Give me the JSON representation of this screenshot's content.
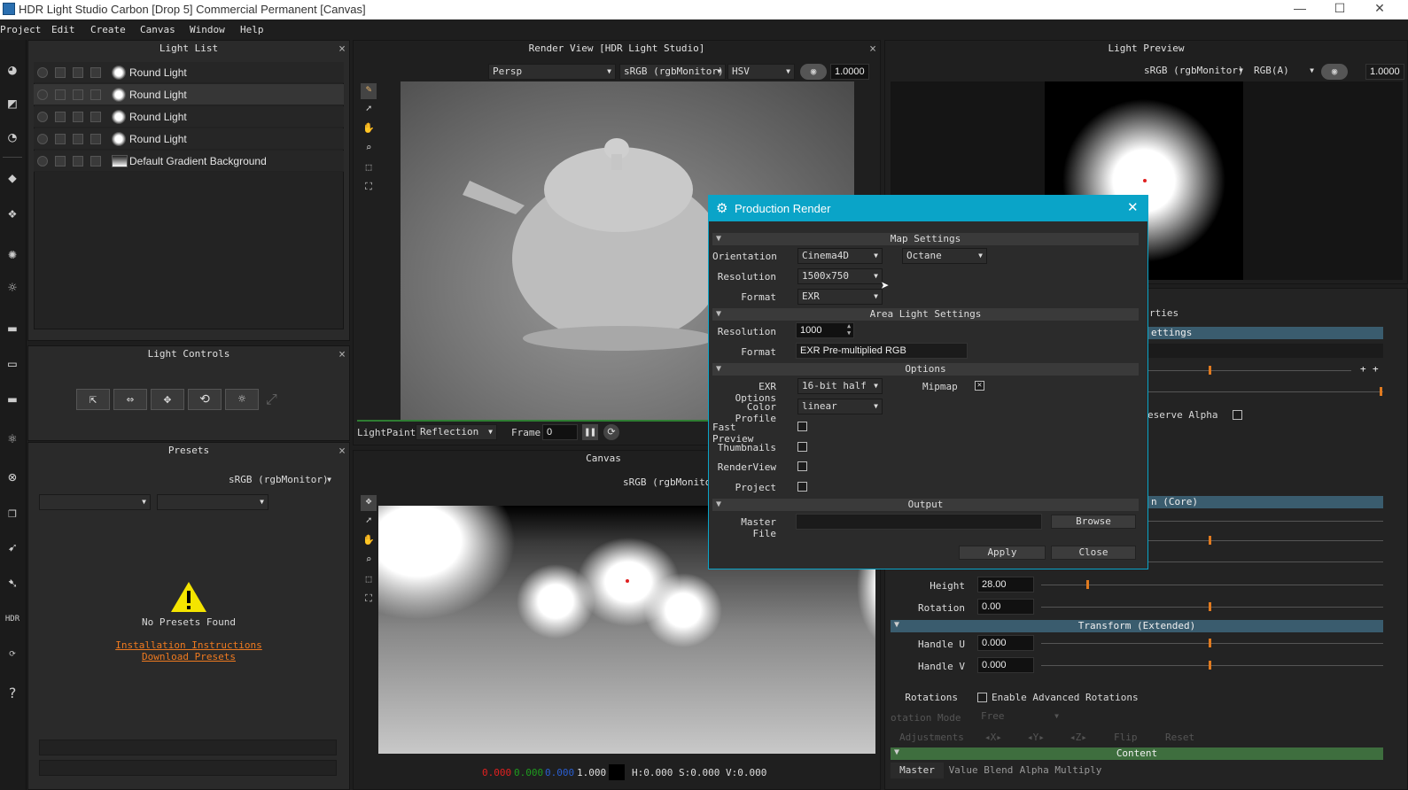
{
  "window": {
    "title": "HDR Light Studio Carbon [Drop 5] Commercial Permanent [Canvas]",
    "minimize": "—",
    "maximize": "☐",
    "close": "✕"
  },
  "menu": [
    "Project",
    "Edit",
    "Create",
    "Canvas",
    "Window",
    "Help"
  ],
  "light_list": {
    "title": "Light List",
    "items": [
      "Round Light",
      "Round Light",
      "Round Light",
      "Round Light",
      "Default Gradient Background"
    ]
  },
  "light_controls": {
    "title": "Light Controls"
  },
  "presets": {
    "title": "Presets",
    "colorspace": "sRGB (rgbMonitor)",
    "empty_text": "No Presets Found",
    "link1": "Installation Instructions",
    "link2": "Download Presets"
  },
  "render_view": {
    "title": "Render View [HDR Light Studio]",
    "camera": "Persp",
    "colorspace": "sRGB (rgbMonitor)",
    "mode": "HSV",
    "exposure": "1.0000",
    "lightpaint_label": "LightPaint",
    "lightpaint_mode": "Reflection",
    "frame_label": "Frame",
    "frame_value": "0"
  },
  "canvas": {
    "title": "Canvas",
    "colorspace": "sRGB (rgbMonitor)",
    "r": "0.000",
    "g": "0.000",
    "b": "0.000",
    "a": "1.000",
    "hsv": "H:0.000 S:0.000 V:0.000"
  },
  "light_preview": {
    "title": "Light Preview",
    "colorspace": "sRGB (rgbMonitor)",
    "mode": "RGB(A)",
    "exposure": "1.0000"
  },
  "properties": {
    "title": "rties",
    "settings": "ettings",
    "preserve_alpha": "eserve Alpha",
    "core": "n (Core)",
    "height_label": "Height",
    "height": "28.00",
    "rotation_label": "Rotation",
    "rotation": "0.00",
    "transform_ext": "Transform (Extended)",
    "handle_u_label": "Handle U",
    "handle_u": "0.000",
    "handle_v_label": "Handle V",
    "handle_v": "0.000",
    "rotations_label": "Rotations",
    "enable_adv": "Enable Advanced Rotations",
    "rotation_mode_label": "otation Mode",
    "rotation_mode": "Free",
    "adjustments_label": "Adjustments",
    "adj_x": "X",
    "adj_y": "Y",
    "adj_z": "Z",
    "flip": "Flip",
    "reset": "Reset",
    "content": "Content",
    "tabs": [
      "Master",
      "Value Blend",
      "Alpha Multiply"
    ]
  },
  "dialog": {
    "title": "Production Render",
    "map_settings": "Map Settings",
    "orientation_label": "Orientation",
    "orientation": "Cinema4D",
    "renderer": "Octane",
    "resolution_label": "Resolution",
    "resolution": "1500x750",
    "format_label": "Format",
    "format": "EXR",
    "area_light_settings": "Area Light Settings",
    "area_resolution_label": "Resolution",
    "area_resolution": "1000",
    "area_format_label": "Format",
    "area_format": "EXR Pre-multiplied RGB",
    "options": "Options",
    "exr_options_label": "EXR Options",
    "exr_options": "16-bit half",
    "mipmap_label": "Mipmap",
    "color_profile_label": "Color Profile",
    "color_profile": "linear",
    "fast_preview_label": "Fast Preview",
    "thumbnails_label": "Thumbnails",
    "renderview_label": "RenderView",
    "project_label": "Project",
    "output": "Output",
    "master_file_label": "Master File",
    "browse": "Browse",
    "apply": "Apply",
    "close": "Close"
  },
  "colors": {
    "accent": "#0aa4c8",
    "orange": "#e07a1f",
    "content_green": "#3e6e3e"
  },
  "icons": [
    "gear-icon",
    "warning-icon",
    "pause-icon",
    "refresh-icon",
    "eye-icon",
    "close-icon"
  ]
}
